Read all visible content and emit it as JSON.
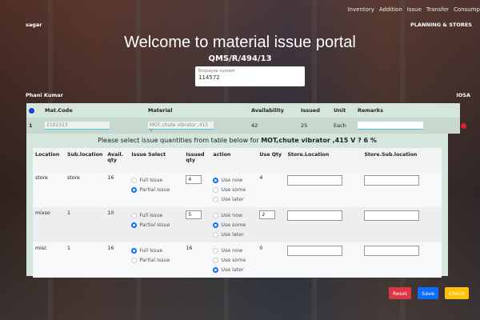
{
  "nav": [
    "Inventory",
    "Addition",
    "Issue",
    "Transfer",
    "Consump"
  ],
  "user": "sagar",
  "department": "PLANNING & STORES",
  "title": "Welcome to material issue portal",
  "doc_code": "QMS/R/494/13",
  "employee": {
    "label": "Employee number",
    "value": "114572"
  },
  "name": "Phani Kumar",
  "org": "IOSA",
  "main_table": {
    "headers": [
      "Mat.Code",
      "Material",
      "Availability",
      "Issued",
      "Unit",
      "Remarks"
    ],
    "row": {
      "index": "1",
      "mat_code": "2102313",
      "material": "MOT,chute vibrator ,415 V",
      "availability": "42",
      "issued": "25",
      "unit": "Each",
      "remarks": ""
    }
  },
  "prompt": {
    "text": "Please select issue quantities from table below for ",
    "material": "MOT,chute vibrator ,415 V ? 6 %"
  },
  "sub_table": {
    "headers": [
      "Location",
      "Sub.location",
      "Avail. qty",
      "Issue Select",
      "Issued qty",
      "action",
      "Use Qty",
      "Store.Location",
      "Store.Sub.location"
    ],
    "issue_options": [
      "Full Issue",
      "Partial Issue"
    ],
    "action_options": [
      "Use now",
      "Use some",
      "Use later"
    ],
    "rows": [
      {
        "location": "store",
        "sublocation": "store",
        "avail": "16",
        "issue_select": "Partial Issue",
        "issued": "4",
        "issued_editable": true,
        "action": "Use now",
        "use_qty": "4",
        "use_editable": false
      },
      {
        "location": "mixso",
        "sublocation": "1",
        "avail": "10",
        "issue_select": "Partial Issue",
        "issued": "5",
        "issued_editable": true,
        "action": "Use some",
        "use_qty": "2",
        "use_editable": true
      },
      {
        "location": "misc",
        "sublocation": "1",
        "avail": "16",
        "issue_select": "Full Issue",
        "issued": "16",
        "issued_editable": false,
        "action": "Use later",
        "use_qty": "0",
        "use_editable": false
      }
    ]
  },
  "buttons": {
    "reset": "Reset",
    "save": "Save",
    "check": "Check"
  },
  "colors": {
    "reset": "#dc3545",
    "save": "#0d6efd",
    "check": "#ffc107",
    "panel": "#d5e6dc"
  }
}
